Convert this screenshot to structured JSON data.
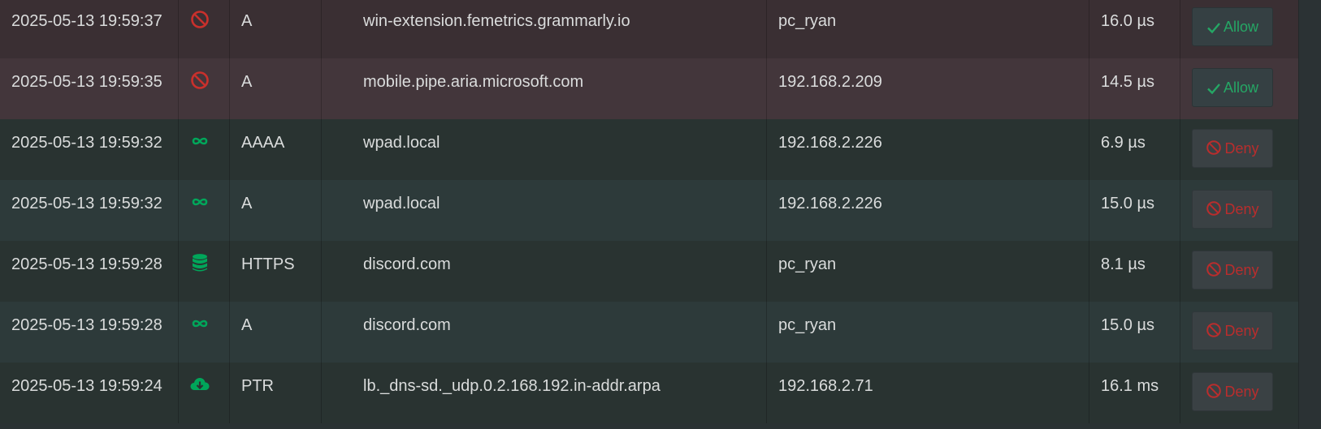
{
  "colors": {
    "blocked_icon": "#c9302c",
    "ok_icon": "#00a65a",
    "allow_text": "#25a765",
    "deny_text": "#b92d2d"
  },
  "rows": [
    {
      "time": "2025-05-13 19:59:37",
      "status_icon": "blocked-icon",
      "type": "A",
      "domain": "win-extension.femetrics.grammarly.io",
      "client": "pc_ryan",
      "duration": "16.0 µs",
      "action": "Allow"
    },
    {
      "time": "2025-05-13 19:59:35",
      "status_icon": "blocked-icon",
      "type": "A",
      "domain": "mobile.pipe.aria.microsoft.com",
      "client": "192.168.2.209",
      "duration": "14.5 µs",
      "action": "Allow"
    },
    {
      "time": "2025-05-13 19:59:32",
      "status_icon": "infinity-icon",
      "type": "AAAA",
      "domain": "wpad.local",
      "client": "192.168.2.226",
      "duration": "6.9 µs",
      "action": "Deny"
    },
    {
      "time": "2025-05-13 19:59:32",
      "status_icon": "infinity-icon",
      "type": "A",
      "domain": "wpad.local",
      "client": "192.168.2.226",
      "duration": "15.0 µs",
      "action": "Deny"
    },
    {
      "time": "2025-05-13 19:59:28",
      "status_icon": "database-icon",
      "type": "HTTPS",
      "domain": "discord.com",
      "client": "pc_ryan",
      "duration": "8.1 µs",
      "action": "Deny"
    },
    {
      "time": "2025-05-13 19:59:28",
      "status_icon": "infinity-icon",
      "type": "A",
      "domain": "discord.com",
      "client": "pc_ryan",
      "duration": "15.0 µs",
      "action": "Deny"
    },
    {
      "time": "2025-05-13 19:59:24",
      "status_icon": "cloud-download-icon",
      "type": "PTR",
      "domain": "lb._dns-sd._udp.0.2.168.192.in-addr.arpa",
      "client": "192.168.2.71",
      "duration": "16.1 ms",
      "action": "Deny"
    }
  ]
}
